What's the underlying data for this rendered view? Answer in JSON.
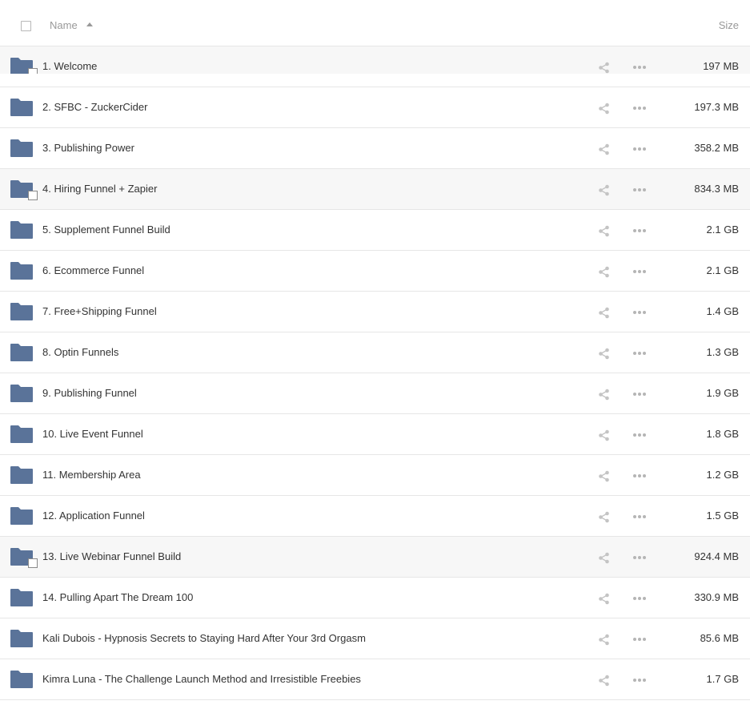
{
  "header": {
    "name_label": "Name",
    "size_label": "Size",
    "sort_direction": "ascending"
  },
  "colors": {
    "folder": "#5a7399",
    "border": "#e6e6e6",
    "highlight_row": "#f7f7f7",
    "muted_text": "#999999",
    "icon_gray": "#b5b5b5"
  },
  "items": [
    {
      "name": "1. Welcome",
      "size": "197 MB",
      "highlight": true,
      "checkbox": true,
      "cut": true
    },
    {
      "name": "2. SFBC - ZuckerCider",
      "size": "197.3 MB",
      "highlight": false,
      "checkbox": false
    },
    {
      "name": "3. Publishing Power",
      "size": "358.2 MB",
      "highlight": false,
      "checkbox": false
    },
    {
      "name": "4. Hiring Funnel + Zapier",
      "size": "834.3 MB",
      "highlight": true,
      "checkbox": true
    },
    {
      "name": "5. Supplement Funnel Build",
      "size": "2.1 GB",
      "highlight": false,
      "checkbox": false
    },
    {
      "name": "6. Ecommerce Funnel",
      "size": "2.1 GB",
      "highlight": false,
      "checkbox": false
    },
    {
      "name": "7. Free+Shipping Funnel",
      "size": "1.4 GB",
      "highlight": false,
      "checkbox": false
    },
    {
      "name": "8. Optin Funnels",
      "size": "1.3 GB",
      "highlight": false,
      "checkbox": false
    },
    {
      "name": "9. Publishing Funnel",
      "size": "1.9 GB",
      "highlight": false,
      "checkbox": false
    },
    {
      "name": "10. Live Event Funnel",
      "size": "1.8 GB",
      "highlight": false,
      "checkbox": false
    },
    {
      "name": "11. Membership Area",
      "size": "1.2 GB",
      "highlight": false,
      "checkbox": false
    },
    {
      "name": "12. Application Funnel",
      "size": "1.5 GB",
      "highlight": false,
      "checkbox": false
    },
    {
      "name": "13. Live Webinar Funnel Build",
      "size": "924.4 MB",
      "highlight": true,
      "checkbox": true
    },
    {
      "name": "14. Pulling Apart The Dream 100",
      "size": "330.9 MB",
      "highlight": false,
      "checkbox": false
    },
    {
      "name": "Kali Dubois - Hypnosis Secrets to Staying Hard After Your 3rd Orgasm",
      "size": "85.6 MB",
      "highlight": false,
      "checkbox": false
    },
    {
      "name": "Kimra Luna - The Challenge Launch Method and Irresistible Freebies",
      "size": "1.7 GB",
      "highlight": false,
      "checkbox": false
    }
  ]
}
